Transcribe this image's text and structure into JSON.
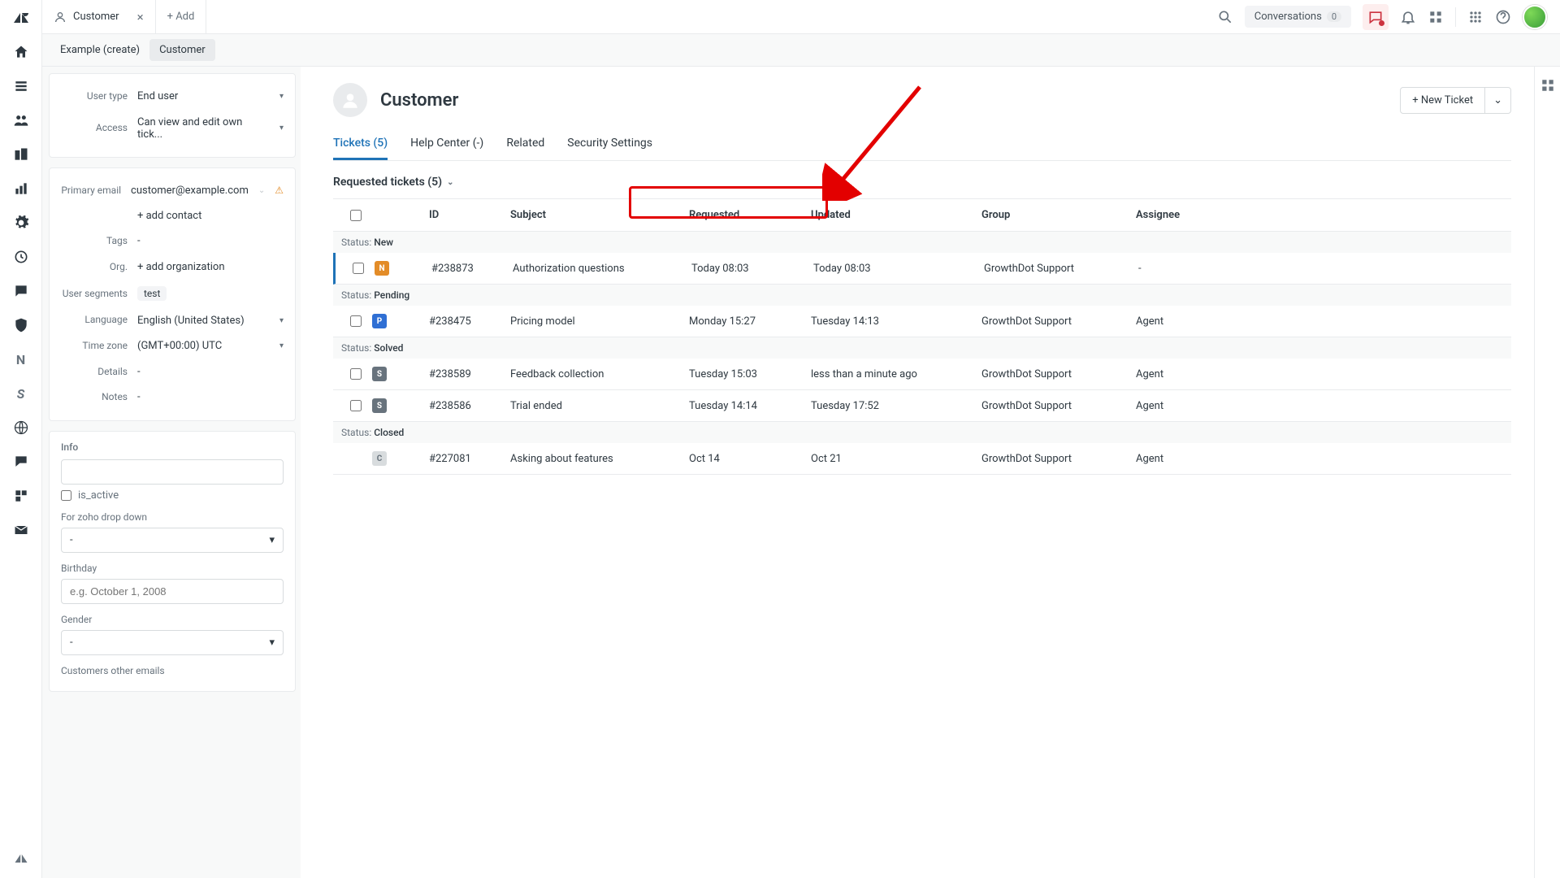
{
  "topbar": {
    "tab_label": "Customer",
    "add_label": "+ Add",
    "conversations_label": "Conversations",
    "conversations_count": "0"
  },
  "breadcrumb": {
    "crumb1": "Example (create)",
    "crumb2": "Customer"
  },
  "sidebar": {
    "user_type_label": "User type",
    "user_type_value": "End user",
    "access_label": "Access",
    "access_value": "Can view and edit own tick...",
    "primary_email_label": "Primary email",
    "primary_email_value": "customer@example.com",
    "add_contact": "+ add contact",
    "tags_label": "Tags",
    "tags_value": "-",
    "org_label": "Org.",
    "add_org": "+ add organization",
    "segments_label": "User segments",
    "segments_value": "test",
    "language_label": "Language",
    "language_value": "English (United States)",
    "timezone_label": "Time zone",
    "timezone_value": "(GMT+00:00) UTC",
    "details_label": "Details",
    "details_value": "-",
    "notes_label": "Notes",
    "notes_value": "-",
    "info_heading": "Info",
    "is_active_label": "is_active",
    "zoho_label": "For zoho drop down",
    "zoho_value": "-",
    "birthday_label": "Birthday",
    "birthday_placeholder": "e.g. October 1, 2008",
    "gender_label": "Gender",
    "gender_value": "-",
    "other_emails_label": "Customers other emails"
  },
  "content": {
    "title": "Customer",
    "new_ticket": "+ New Ticket",
    "tabs": {
      "tickets": "Tickets (5)",
      "help": "Help Center (-)",
      "related": "Related",
      "security": "Security Settings"
    },
    "filter_label": "Requested tickets (5)",
    "columns": {
      "id": "ID",
      "subject": "Subject",
      "requested": "Requested",
      "updated": "Updated",
      "group": "Group",
      "assignee": "Assignee"
    },
    "statuses": {
      "new": "New",
      "pending": "Pending",
      "solved": "Solved",
      "closed": "Closed",
      "prefix": "Status: "
    },
    "rows": {
      "r0": {
        "badge": "N",
        "id": "#238873",
        "subject": "Authorization questions",
        "requested": "Today 08:03",
        "updated": "Today 08:03",
        "group": "GrowthDot Support",
        "assignee": "-"
      },
      "r1": {
        "badge": "P",
        "id": "#238475",
        "subject": "Pricing model",
        "requested": "Monday 15:27",
        "updated": "Tuesday 14:13",
        "group": "GrowthDot Support",
        "assignee": "Agent"
      },
      "r2": {
        "badge": "S",
        "id": "#238589",
        "subject": "Feedback collection",
        "requested": "Tuesday 15:03",
        "updated": "less than a minute ago",
        "group": "GrowthDot Support",
        "assignee": "Agent"
      },
      "r3": {
        "badge": "S",
        "id": "#238586",
        "subject": "Trial ended",
        "requested": "Tuesday 14:14",
        "updated": "Tuesday 17:52",
        "group": "GrowthDot Support",
        "assignee": "Agent"
      },
      "r4": {
        "badge": "C",
        "id": "#227081",
        "subject": "Asking about features",
        "requested": "Oct 14",
        "updated": "Oct 21",
        "group": "GrowthDot Support",
        "assignee": "Agent"
      }
    }
  }
}
